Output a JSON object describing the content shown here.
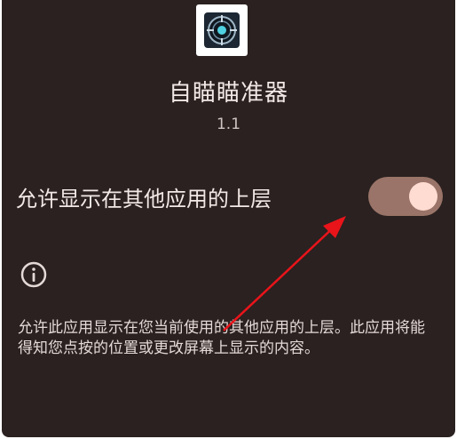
{
  "app": {
    "name": "自瞄瞄准器",
    "version": "1.1",
    "icon": "crosshair-scope-icon"
  },
  "setting": {
    "label": "允许显示在其他应用的上层",
    "toggle_on": true
  },
  "info": {
    "icon": "info-icon",
    "description": "允许此应用显示在您当前使用的其他应用的上层。此应用将能得知您点按的位置或更改屏幕上显示的内容。"
  },
  "annotation": {
    "arrow": "red-arrow-pointing-to-toggle",
    "color": "#e8141a"
  },
  "colors": {
    "background": "#2a2120",
    "toggle_track": "#9a7468",
    "toggle_thumb": "#ffdcd2",
    "text": "#f2e9e6"
  }
}
